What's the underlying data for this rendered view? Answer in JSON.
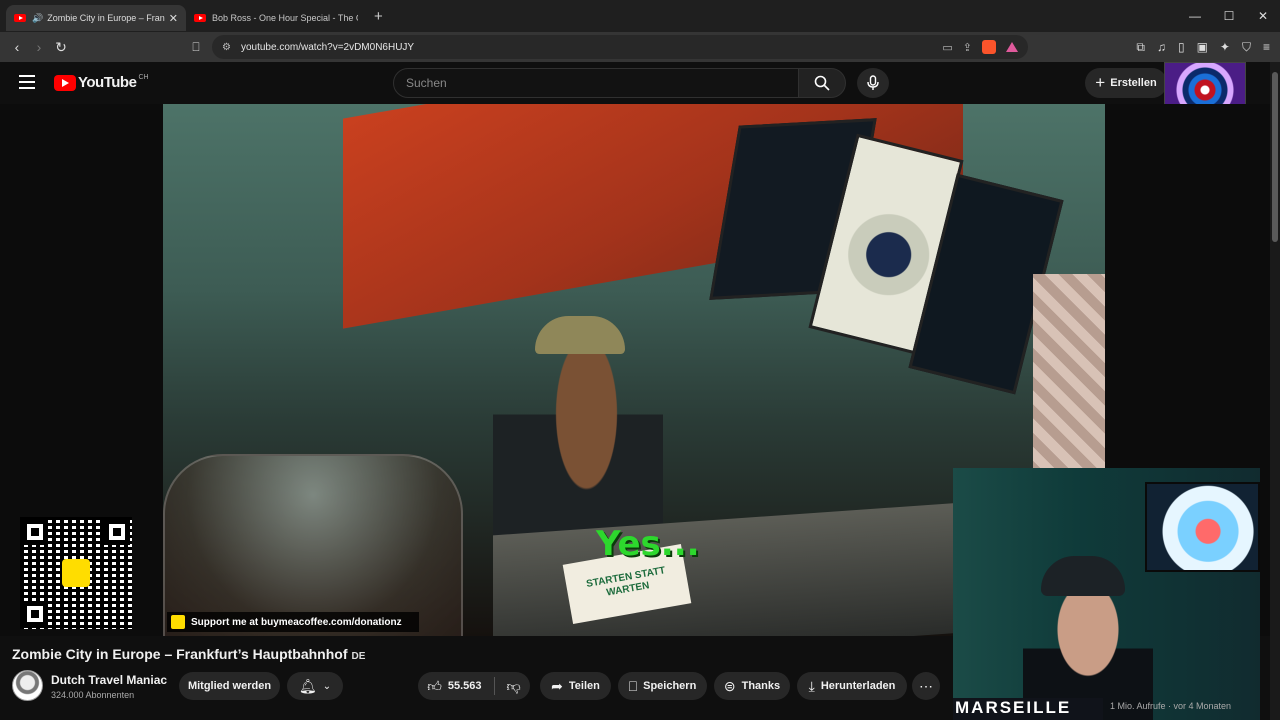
{
  "browser": {
    "tabs": [
      {
        "label": "Zombie City in Europe – Frankfurt",
        "active": true
      },
      {
        "label": "Bob Ross - One Hour Special - The G",
        "active": false
      }
    ],
    "url": "youtube.com/watch?v=2vDM0N6HUJY",
    "badge": "10+"
  },
  "youtube": {
    "logo_text": "YouTube",
    "region": "CH",
    "search_placeholder": "Suchen",
    "create_label": "Erstellen"
  },
  "video": {
    "caption_text": "Yes...",
    "card_text": "STARTEN STATT WARTEN",
    "support_text": "Support me at buymeacoffee.com/donationz",
    "cam_banner": "MARSEILLE"
  },
  "info": {
    "title": "Zombie City in Europe – Frankfurt’s Hauptbahnhof",
    "lang_badge": "DE",
    "channel_name": "Dutch Travel Maniac",
    "subscribers": "324.000 Abonnenten",
    "join_label": "Mitglied werden",
    "like_count": "55.563",
    "share_label": "Teilen",
    "save_label": "Speichern",
    "thanks_label": "Thanks",
    "download_label": "Herunterladen",
    "views_text": "1 Mio. Aufrufe · vor 4 Monaten"
  },
  "colors": {
    "yt_red": "#ff0000",
    "caption_green": "#2dd82d",
    "bmc_yellow": "#ffdd00"
  }
}
